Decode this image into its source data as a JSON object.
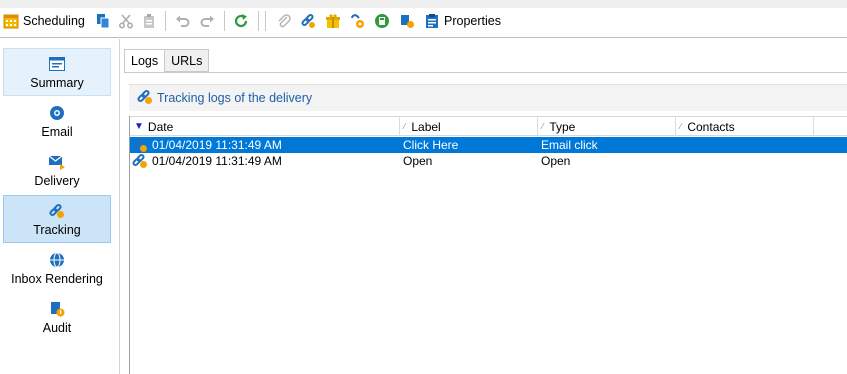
{
  "toolbar": {
    "scheduling_label": "Scheduling",
    "properties_label": "Properties"
  },
  "nav": {
    "summary": "Summary",
    "email": "Email",
    "delivery": "Delivery",
    "tracking": "Tracking",
    "inbox_rendering": "Inbox Rendering",
    "audit": "Audit"
  },
  "tabs": {
    "logs": "Logs",
    "urls": "URLs"
  },
  "panel": {
    "title": "Tracking logs of the delivery"
  },
  "grid": {
    "columns": {
      "date": "Date",
      "label": "Label",
      "type": "Type",
      "contacts": "Contacts"
    },
    "rows": [
      {
        "date": "01/04/2019 11:31:49 AM",
        "label": "Click Here",
        "type": "Email click",
        "contacts": ""
      },
      {
        "date": "01/04/2019 11:31:49 AM",
        "label": "Open",
        "type": "Open",
        "contacts": ""
      }
    ]
  },
  "colors": {
    "selection": "#0078d7",
    "nav_selected": "#cce4f7",
    "link_blue": "#1f5fa8"
  }
}
